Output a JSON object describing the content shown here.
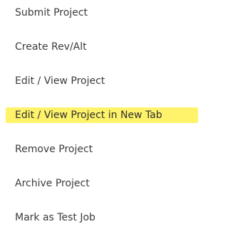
{
  "menu": {
    "items": [
      {
        "label": "Submit Project"
      },
      {
        "label": "Create Rev/Alt"
      },
      {
        "label": "Edit / View Project"
      },
      {
        "label": "Edit / View Project in New Tab"
      },
      {
        "label": "Remove Project"
      },
      {
        "label": "Archive Project"
      },
      {
        "label": "Mark as Test Job"
      }
    ],
    "highlight_color": "#fff36b",
    "text_color": "#3b3b3b"
  }
}
